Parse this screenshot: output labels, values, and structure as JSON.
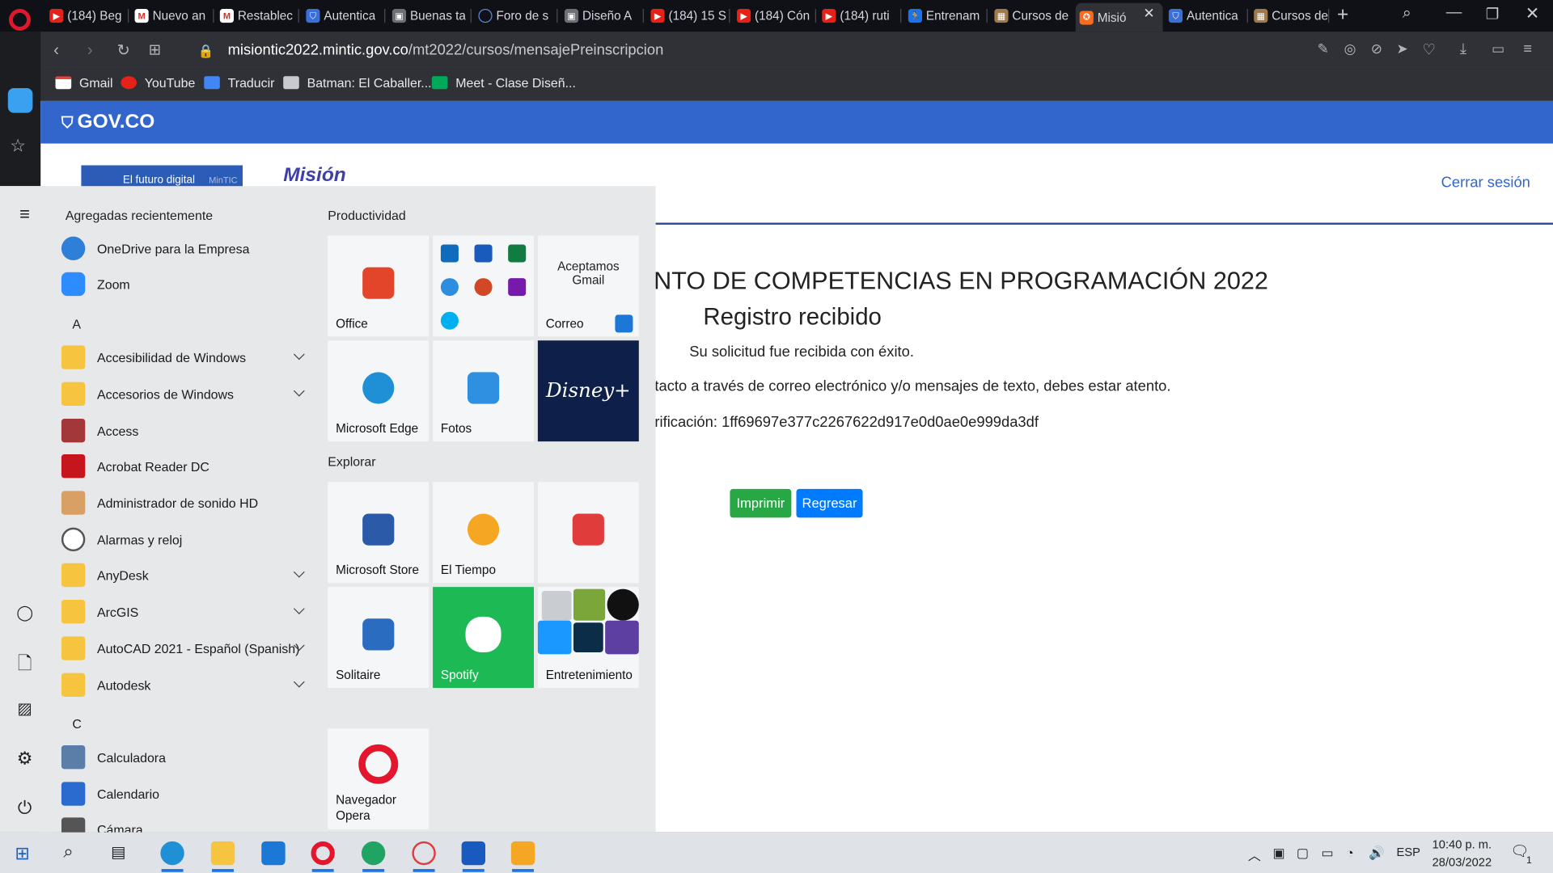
{
  "browser": {
    "tabs": [
      {
        "label": "(184) Beg",
        "favicon": "youtube-icon"
      },
      {
        "label": "Nuevo an",
        "favicon": "gmail-icon"
      },
      {
        "label": "Restablec",
        "favicon": "gmail-icon"
      },
      {
        "label": "Autentica",
        "favicon": "shield-icon"
      },
      {
        "label": "Buenas ta",
        "favicon": "classroom-icon"
      },
      {
        "label": "Foro de s",
        "favicon": "forum-icon"
      },
      {
        "label": "Diseño A",
        "favicon": "classroom-icon"
      },
      {
        "label": "(184) 15 S",
        "favicon": "youtube-icon"
      },
      {
        "label": "(184) Cón",
        "favicon": "youtube-icon"
      },
      {
        "label": "(184) ruti",
        "favicon": "youtube-icon"
      },
      {
        "label": "Entrenam",
        "favicon": "runner-icon"
      },
      {
        "label": "Cursos de",
        "favicon": "course-icon"
      },
      {
        "label": "Misió",
        "favicon": "mision-icon",
        "active": true
      },
      {
        "label": "Autentica",
        "favicon": "shield-icon"
      },
      {
        "label": "Cursos de",
        "favicon": "course-icon"
      }
    ],
    "url_domain": "misiontic2022.mintic.gov.co",
    "url_path": "/mt2022/cursos/mensajePreinscripcion",
    "bookmarks": [
      {
        "label": "Gmail",
        "icon": "gmail-icon"
      },
      {
        "label": "YouTube",
        "icon": "youtube-icon"
      },
      {
        "label": "Traducir",
        "icon": "translate-icon"
      },
      {
        "label": "Batman: El Caballer...",
        "icon": "film-icon"
      },
      {
        "label": "Meet - Clase Diseñ...",
        "icon": "meet-icon"
      }
    ]
  },
  "page": {
    "gov_logo": "GOV.CO",
    "mintic_banner": "El futuro digital",
    "mintic_tag": "MinTIC",
    "mision_logo": "Misión",
    "logout": "Cerrar sesión",
    "heading": "NTO DE COMPETENCIAS EN PROGRAMACIÓN 2022",
    "subheading": "Registro recibido",
    "success": "Su solicitud fue recibida con éxito.",
    "contact": "tacto a través de correo electrónico y/o mensajes de texto, debes estar atento.",
    "verification": "rificación: 1ff69697e377c2267622d917e0d0ae0e999da3df",
    "print_button": "Imprimir",
    "back_button": "Regresar"
  },
  "start_menu": {
    "recent_header": "Agregadas recientemente",
    "recent": [
      {
        "label": "OneDrive para la Empresa",
        "icon": "onedrive-icon"
      },
      {
        "label": "Zoom",
        "icon": "zoom-icon"
      }
    ],
    "letter_a": "A",
    "apps_a": [
      {
        "label": "Accesibilidad de Windows",
        "icon": "folder-icon",
        "expand": true
      },
      {
        "label": "Accesorios de Windows",
        "icon": "folder-icon",
        "expand": true
      },
      {
        "label": "Access",
        "icon": "access-icon"
      },
      {
        "label": "Acrobat Reader DC",
        "icon": "acrobat-icon"
      },
      {
        "label": "Administrador de sonido HD",
        "icon": "speaker-icon"
      },
      {
        "label": "Alarmas y reloj",
        "icon": "clock-icon"
      },
      {
        "label": "AnyDesk",
        "icon": "folder-icon",
        "expand": true
      },
      {
        "label": "ArcGIS",
        "icon": "folder-icon",
        "expand": true
      },
      {
        "label": "AutoCAD 2021 - Español (Spanish)",
        "icon": "folder-icon",
        "expand": true
      },
      {
        "label": "Autodesk",
        "icon": "folder-icon",
        "expand": true
      }
    ],
    "letter_c": "C",
    "apps_c": [
      {
        "label": "Calculadora",
        "icon": "calculator-icon"
      },
      {
        "label": "Calendario",
        "icon": "calendar-icon"
      },
      {
        "label": "Cámara",
        "icon": "camera-icon"
      }
    ],
    "productivity_header": "Productividad",
    "explore_header": "Explorar",
    "tiles": {
      "office": "Office",
      "mail_promo": "Aceptamos Gmail",
      "mail": "Correo",
      "edge": "Microsoft Edge",
      "photos": "Fotos",
      "disney": "Disney+",
      "store": "Microsoft Store",
      "weather": "El Tiempo",
      "solitaire": "Solitaire",
      "spotify": "Spotify",
      "entertainment": "Entretenimiento",
      "opera": "Navegador Opera"
    }
  },
  "taskbar": {
    "language": "ESP",
    "time": "10:40 p. m.",
    "date": "28/03/2022",
    "notifications": "1"
  },
  "colors": {
    "gov_blue": "#3366cc",
    "btn_green": "#28a745",
    "btn_blue": "#007bff",
    "spotify": "#1db954",
    "disney": "#0e1f4a"
  }
}
